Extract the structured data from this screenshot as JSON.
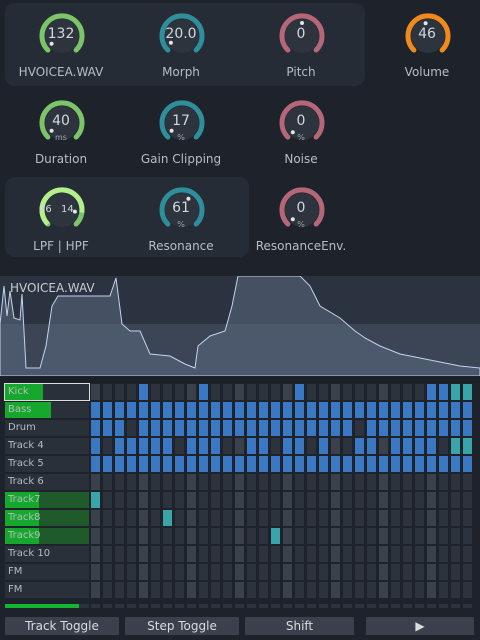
{
  "colors": {
    "green": "#7cc46a",
    "teal": "#2f8e9c",
    "rose": "#b56678",
    "orange": "#f08a1c",
    "light_green": "#b5ef8a",
    "seq_blue": "#3a78c4",
    "seq_teal": "#3aa5a8",
    "seq_dim": "#2d333c",
    "seq_beat": "#3a414b",
    "track_green": "#16a82d"
  },
  "knobs": [
    {
      "id": "sample",
      "value": "132",
      "unit": "",
      "label": "HVOICEA.WAV",
      "color": "green",
      "level": 0.03
    },
    {
      "id": "morph",
      "value": "20.0",
      "unit": "",
      "label": "Morph",
      "color": "teal",
      "level": 0.05
    },
    {
      "id": "pitch",
      "value": "0",
      "unit": "",
      "label": "Pitch",
      "color": "rose",
      "level": 0.5
    },
    {
      "id": "volume",
      "value": "46",
      "unit": "",
      "label": "Volume",
      "color": "orange",
      "level": 0.46
    },
    {
      "id": "duration",
      "value": "40",
      "unit": "ms",
      "label": "Duration",
      "color": "green",
      "level": 0.03
    },
    {
      "id": "gain_clipping",
      "value": "17",
      "unit": "%",
      "label": "Gain Clipping",
      "color": "teal",
      "level": 0.03
    },
    {
      "id": "noise",
      "value": "0",
      "unit": "%",
      "label": "Noise",
      "color": "rose",
      "level": 0.0
    },
    {
      "id": "resonance",
      "value": "61",
      "unit": "%",
      "label": "Resonance",
      "color": "teal",
      "level": 0.61
    },
    {
      "id": "resonance_env",
      "value": "0",
      "unit": "%",
      "label": "ResonanceEnv.",
      "color": "rose",
      "level": 0.0
    }
  ],
  "filter": {
    "lpf": "86",
    "hpf": "14",
    "label": "LPF | HPF"
  },
  "waveform": {
    "title": "HVOICEA.WAV"
  },
  "tracks": [
    {
      "name": "Kick",
      "fill": 0.45,
      "selected": true
    },
    {
      "name": "Bass",
      "fill": 0.55
    },
    {
      "name": "Drum",
      "fill": 0
    },
    {
      "name": "Track 4",
      "fill": 0
    },
    {
      "name": "Track 5",
      "fill": 0
    },
    {
      "name": "Track 6",
      "fill": 0
    },
    {
      "name": "Track7",
      "fill": 0.4,
      "active": true
    },
    {
      "name": "Track8",
      "fill": 0.4,
      "active": true
    },
    {
      "name": "Track9",
      "fill": 0.4,
      "active": true
    },
    {
      "name": "Track 10",
      "fill": 0
    },
    {
      "name": "FM",
      "fill": 0
    },
    {
      "name": "FM",
      "fill": 0
    }
  ],
  "pattern": [
    "0000b0000b0000000b0000000000bbttt",
    "bbbbbbbbbbbbbbbbbbbbbbbbbbbbbbbbb",
    "bbb0bbbbbbbbbbbbbbbbbb0bbbbbbbbbb",
    "b0bbbbb0bbb00bb0bb0b00bb0bbbb0ttt",
    "bbbbbbbbbbbbbbbbbbbbbbbbbbbbbbbbb",
    "000000000000000000000000000000000",
    "t00000000000000000000000000000000",
    "000000t0000000000000000000000000",
    "000000000000000t00000000000000000",
    "000000000000000000000000000000000",
    "000000000000000000000000000000000",
    "000000000000000000000000000000000"
  ],
  "level_meter": 0.88,
  "buttons": {
    "track_toggle": "Track Toggle",
    "step_toggle": "Step Toggle",
    "shift": "Shift",
    "play": "▶"
  }
}
